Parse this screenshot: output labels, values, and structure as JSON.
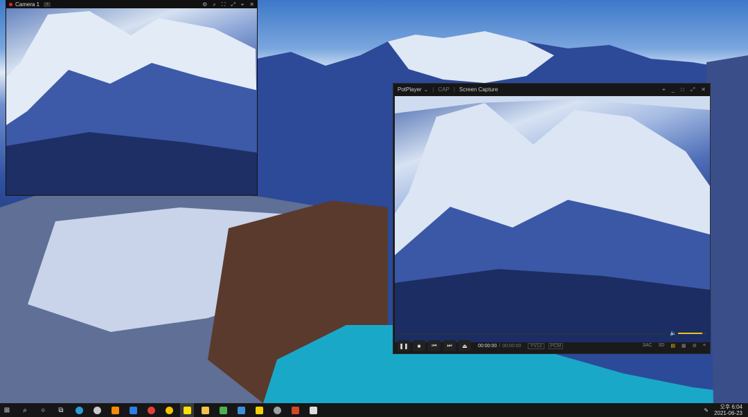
{
  "camera": {
    "title": "Camera 1",
    "tag": "+"
  },
  "player": {
    "app_name": "PotPlayer",
    "mode": "CAP",
    "title": "Screen Capture",
    "time_current": "00:00:00",
    "time_separator": "/",
    "time_total": "00:00:00",
    "format1": "YV12",
    "format2": "PCM",
    "right_labels": [
      "3AC",
      "3D"
    ],
    "volume_level": 0.88,
    "accent_color": "#f0c419"
  },
  "taskbar": {
    "clock_line1": "오후 6:04",
    "clock_line2": "2021-06-23",
    "apps": [
      "windows-start",
      "search",
      "cortana",
      "task-view",
      "edge",
      "app-a",
      "sublime",
      "todo",
      "chrome",
      "app-yellow",
      "kakaotalk",
      "explorer",
      "app-green",
      "photos",
      "app-note",
      "app-globe",
      "powerpoint",
      "store"
    ]
  }
}
